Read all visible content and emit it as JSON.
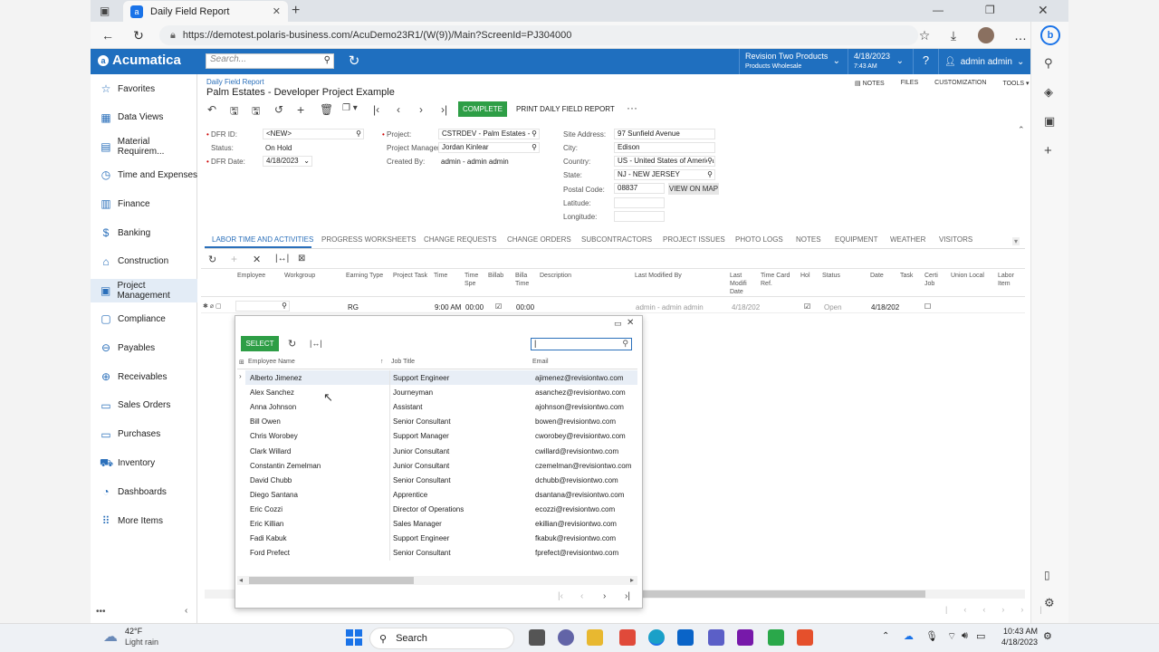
{
  "browser": {
    "tab_title": "Daily Field Report",
    "url": "https://demotest.polaris-business.com/AcuDemo23R1/(W(9))/Main?ScreenId=PJ304000"
  },
  "header": {
    "brand": "Acumatica",
    "search_placeholder": "Search...",
    "company": "Revision Two Products",
    "branch": "Products Wholesale",
    "date": "4/18/2023",
    "time": "7:43 AM",
    "user": "admin admin"
  },
  "nav": [
    {
      "label": "Favorites",
      "icon": "star-icon"
    },
    {
      "label": "Data Views",
      "icon": "data-views-icon"
    },
    {
      "label": "Material Requirem...",
      "icon": "material-icon"
    },
    {
      "label": "Time and Expenses",
      "icon": "clock-icon"
    },
    {
      "label": "Finance",
      "icon": "finance-icon"
    },
    {
      "label": "Banking",
      "icon": "dollar-icon"
    },
    {
      "label": "Construction",
      "icon": "construction-icon"
    },
    {
      "label": "Project Management",
      "icon": "project-icon"
    },
    {
      "label": "Compliance",
      "icon": "compliance-icon"
    },
    {
      "label": "Payables",
      "icon": "payables-icon"
    },
    {
      "label": "Receivables",
      "icon": "receivables-icon"
    },
    {
      "label": "Sales Orders",
      "icon": "sales-icon"
    },
    {
      "label": "Purchases",
      "icon": "purchases-icon"
    },
    {
      "label": "Inventory",
      "icon": "truck-icon"
    },
    {
      "label": "Dashboards",
      "icon": "dashboard-icon"
    },
    {
      "label": "More Items",
      "icon": "grid-icon"
    }
  ],
  "page": {
    "breadcrumb": "Daily Field Report",
    "title": "Palm Estates - Developer Project Example",
    "complete_btn": "COMPLETE",
    "print_btn": "PRINT DAILY FIELD REPORT",
    "top_links": [
      "NOTES",
      "FILES",
      "CUSTOMIZATION",
      "TOOLS"
    ]
  },
  "form": {
    "dfr_id_label": "DFR ID:",
    "dfr_id": "<NEW>",
    "status_label": "Status:",
    "status": "On Hold",
    "dfr_date_label": "DFR Date:",
    "dfr_date": "4/18/2023",
    "project_label": "Project:",
    "project": "CSTRDEV - Palm Estates - D",
    "pm_label": "Project Manager:",
    "pm": "Jordan Kinlear",
    "created_label": "Created By:",
    "created": "admin - admin admin",
    "site_label": "Site Address:",
    "site": "97 Sunfield Avenue",
    "city_label": "City:",
    "city": "Edison",
    "country_label": "Country:",
    "country": "US - United States of America",
    "state_label": "State:",
    "state": "NJ - NEW JERSEY",
    "postal_label": "Postal Code:",
    "postal": "08837",
    "view_map": "VIEW ON MAP",
    "lat_label": "Latitude:",
    "lon_label": "Longitude:"
  },
  "tabs": [
    "LABOR TIME AND ACTIVITIES",
    "PROGRESS WORKSHEETS",
    "CHANGE REQUESTS",
    "CHANGE ORDERS",
    "SUBCONTRACTORS",
    "PROJECT ISSUES",
    "PHOTO LOGS",
    "NOTES",
    "EQUIPMENT",
    "WEATHER",
    "VISITORS"
  ],
  "grid": {
    "headers": [
      "Employee",
      "Workgroup",
      "Earning Type",
      "Project Task",
      "Time",
      "Time Spe",
      "Billab",
      "Billa Time",
      "Description",
      "Last Modified By",
      "Last Modifi Date",
      "Time Card Ref.",
      "Hol",
      "Status",
      "Date",
      "Task",
      "Certi Job",
      "Union Local",
      "Labor Item"
    ],
    "row": {
      "earning": "RG",
      "time": "9:00 AM",
      "spent": "00:00",
      "billable": "00:00",
      "modified_by": "admin - admin admin",
      "modified_date": "4/18/202",
      "status": "Open",
      "date": "4/18/202"
    }
  },
  "dialog": {
    "select_btn": "SELECT",
    "col_name": "Employee Name",
    "col_job": "Job Title",
    "col_email": "Email",
    "rows": [
      {
        "name": "Alberto Jimenez",
        "job": "Support Engineer",
        "email": "ajimenez@revisiontwo.com"
      },
      {
        "name": "Alex Sanchez",
        "job": "Journeyman",
        "email": "asanchez@revisiontwo.com"
      },
      {
        "name": "Anna Johnson",
        "job": "Assistant",
        "email": "ajohnson@revisiontwo.com"
      },
      {
        "name": "Bill Owen",
        "job": "Senior Consultant",
        "email": "bowen@revisiontwo.com"
      },
      {
        "name": "Chris Worobey",
        "job": "Support Manager",
        "email": "cworobey@revisiontwo.com"
      },
      {
        "name": "Clark Willard",
        "job": "Junior Consultant",
        "email": "cwillard@revisiontwo.com"
      },
      {
        "name": "Constantin Zemelman",
        "job": "Junior Consultant",
        "email": "czemelman@revisiontwo.com"
      },
      {
        "name": "David Chubb",
        "job": "Senior Consultant",
        "email": "dchubb@revisiontwo.com"
      },
      {
        "name": "Diego Santana",
        "job": "Apprentice",
        "email": "dsantana@revisiontwo.com"
      },
      {
        "name": "Eric Cozzi",
        "job": "Director of Operations",
        "email": "ecozzi@revisiontwo.com"
      },
      {
        "name": "Eric Killian",
        "job": "Sales Manager",
        "email": "ekillian@revisiontwo.com"
      },
      {
        "name": "Fadi Kabuk",
        "job": "Support Engineer",
        "email": "fkabuk@revisiontwo.com"
      },
      {
        "name": "Ford Prefect",
        "job": "Senior Consultant",
        "email": "fprefect@revisiontwo.com"
      }
    ]
  },
  "taskbar": {
    "weather_temp": "42°F",
    "weather_desc": "Light rain",
    "search": "Search",
    "time": "10:43 AM",
    "date": "4/18/2023"
  },
  "colors": {
    "brand": "#1f6fbf",
    "green": "#2e9e46"
  }
}
